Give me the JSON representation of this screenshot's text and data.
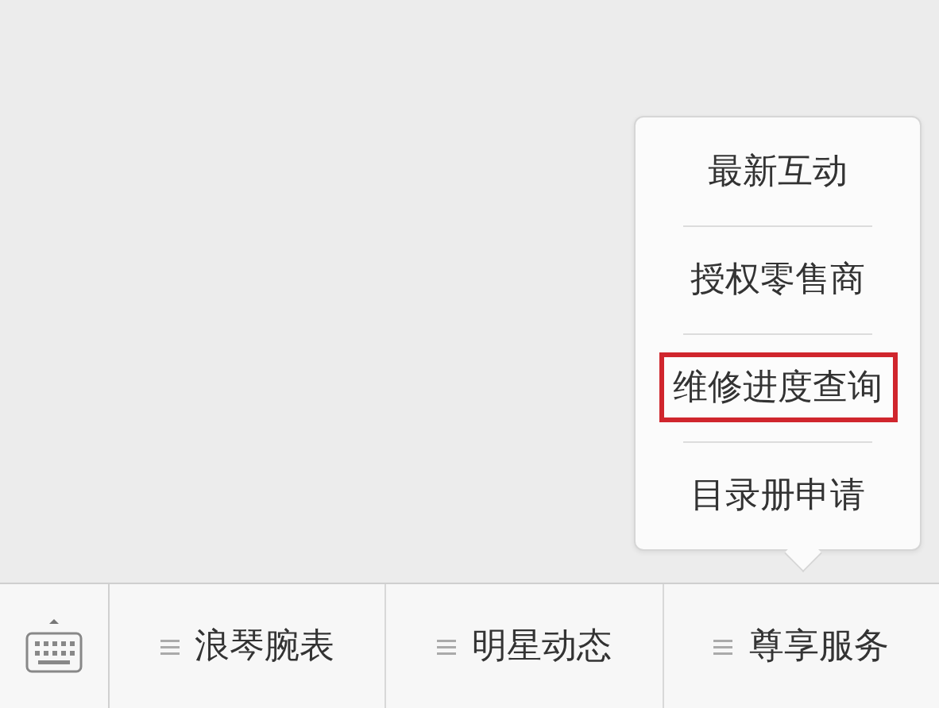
{
  "submenu": {
    "items": [
      {
        "label": "最新互动",
        "highlighted": false
      },
      {
        "label": "授权零售商",
        "highlighted": false
      },
      {
        "label": "维修进度查询",
        "highlighted": true
      },
      {
        "label": "目录册申请",
        "highlighted": false
      }
    ]
  },
  "menu_bar": {
    "items": [
      {
        "label": "浪琴腕表"
      },
      {
        "label": "明星动态"
      },
      {
        "label": "尊享服务"
      }
    ]
  }
}
